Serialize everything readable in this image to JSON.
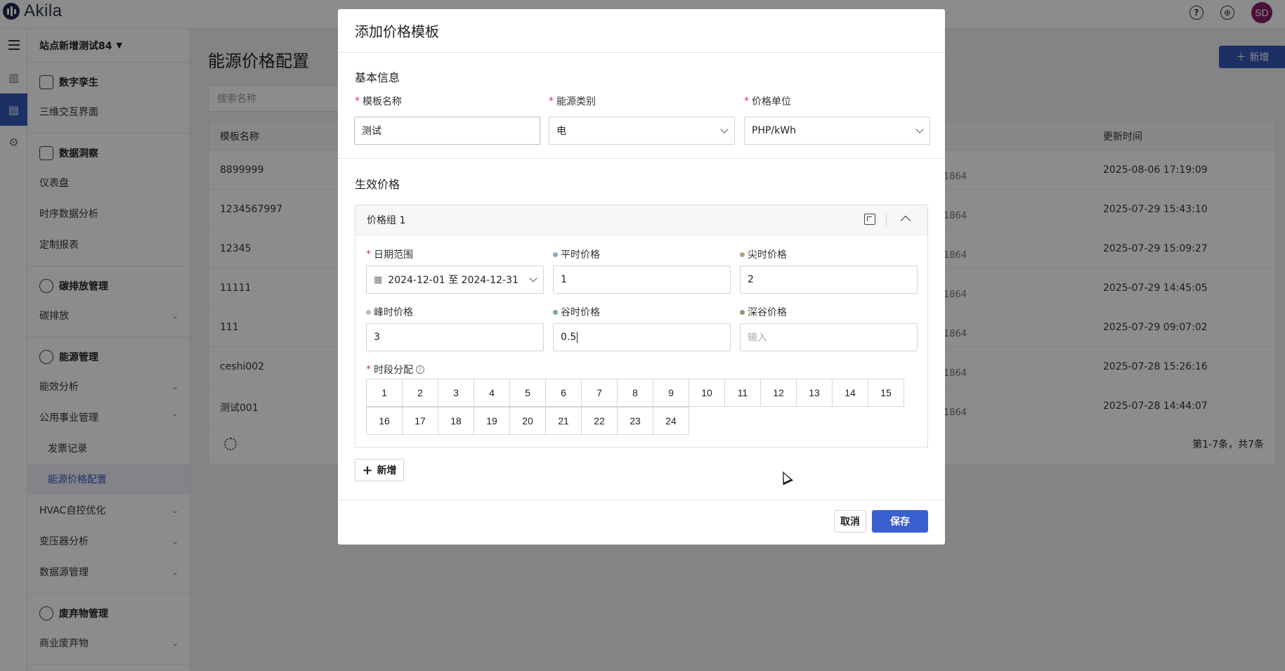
{
  "app": {
    "logo_text": "Akila",
    "avatar_initials": "SD",
    "help_icon": "?",
    "globe_icon": "⊕"
  },
  "sidebar": {
    "site": "站点新增测试84",
    "groups": [
      {
        "title": "数字孪生",
        "items": [
          "三维交互界面"
        ]
      },
      {
        "title": "数据洞察",
        "items": [
          "仪表盘",
          "时序数据分析",
          "定制报表"
        ]
      },
      {
        "title": "碳排放管理",
        "items": [
          "碳排放"
        ]
      },
      {
        "title": "能源管理",
        "items": [
          "能效分析",
          "公用事业管理",
          "发票记录",
          "能源价格配置",
          "HVAC自控优化",
          "变压器分析",
          "数据源管理"
        ]
      },
      {
        "title": "废弃物管理",
        "items": [
          "商业废弃物"
        ]
      }
    ]
  },
  "page": {
    "title": "能源价格配置",
    "add_button": "新增",
    "search_placeholder": "搜索名称",
    "columns": {
      "name": "模板名称",
      "updated": "更新时间"
    },
    "rows": [
      {
        "name": "8899999",
        "mid": "1864",
        "updated": "2025-08-06 17:19:09"
      },
      {
        "name": "1234567997",
        "mid": "1864",
        "updated": "2025-07-29 15:43:10"
      },
      {
        "name": "12345",
        "mid": "1864",
        "updated": "2025-07-29 15:09:27"
      },
      {
        "name": "11111",
        "mid": "1864",
        "updated": "2025-07-29 14:45:05"
      },
      {
        "name": "111",
        "mid": "1864",
        "updated": "2025-07-29 09:07:02"
      },
      {
        "name": "ceshi002",
        "mid": "1864",
        "updated": "2025-07-28 15:26:16"
      },
      {
        "name": "测试001",
        "mid": "1864",
        "updated": "2025-07-28 14:44:07"
      }
    ],
    "pagination": "第1-7条，共7条"
  },
  "modal": {
    "title": "添加价格模板",
    "basic_section": "基本信息",
    "template_name": {
      "label": "模板名称",
      "value": "测试"
    },
    "energy_type": {
      "label": "能源类别",
      "value": "电"
    },
    "price_unit": {
      "label": "价格单位",
      "value": "PHP/kWh"
    },
    "effective_section": "生效价格",
    "group": {
      "title": "价格组 1",
      "date_range": {
        "label": "日期范围",
        "value": "2024-12-01 至 2024-12-31"
      },
      "normal_price": {
        "label": "平时价格",
        "value": "1",
        "color": "#8fa7d8"
      },
      "sharp_price": {
        "label": "尖时价格",
        "value": "2",
        "color": "#b8a37a"
      },
      "peak_price": {
        "label": "峰时价格",
        "value": "3",
        "color": "#c9b8a8"
      },
      "valley_price": {
        "label": "谷时价格",
        "value": "0.5",
        "color": "#7fa898"
      },
      "deep_valley_price": {
        "label": "深谷价格",
        "value": "",
        "placeholder": "输入",
        "color": "#9a9470"
      },
      "time_slots_label": "时段分配",
      "slots_row1": [
        "1",
        "2",
        "3",
        "4",
        "5",
        "6",
        "7",
        "8",
        "9",
        "10",
        "11",
        "12",
        "13",
        "14",
        "15"
      ],
      "slots_row2": [
        "16",
        "17",
        "18",
        "19",
        "20",
        "21",
        "22",
        "23",
        "24"
      ]
    },
    "add_group_button": "新增",
    "cancel_button": "取消",
    "save_button": "保存"
  }
}
